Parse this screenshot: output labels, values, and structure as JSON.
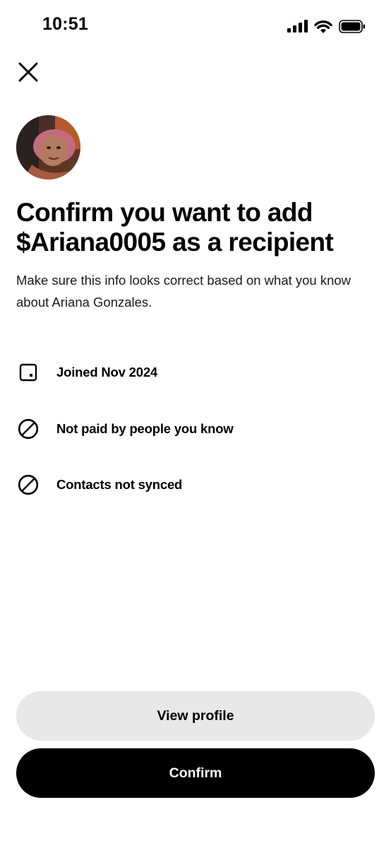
{
  "status_bar": {
    "time": "10:51",
    "icons": [
      "cellular-signal-icon",
      "wifi-icon",
      "battery-icon"
    ]
  },
  "header": {
    "close_icon": "close-icon"
  },
  "recipient": {
    "avatar_alt": "profile-photo"
  },
  "content": {
    "title": "Confirm you want to add $Ariana0005 as a recipient",
    "subtitle": "Make sure this info looks correct based on what you know about Ariana Gonzales."
  },
  "info_items": [
    {
      "icon": "joined-date-icon",
      "label": "Joined Nov 2024"
    },
    {
      "icon": "prohibited-icon",
      "label": "Not paid by people you know"
    },
    {
      "icon": "prohibited-icon",
      "label": "Contacts not synced"
    }
  ],
  "actions": {
    "view_profile_label": "View profile",
    "confirm_label": "Confirm"
  },
  "colors": {
    "background": "#ffffff",
    "text": "#000000",
    "secondary_button_bg": "#e8e8e8",
    "primary_button_bg": "#000000",
    "primary_button_text": "#ffffff"
  }
}
